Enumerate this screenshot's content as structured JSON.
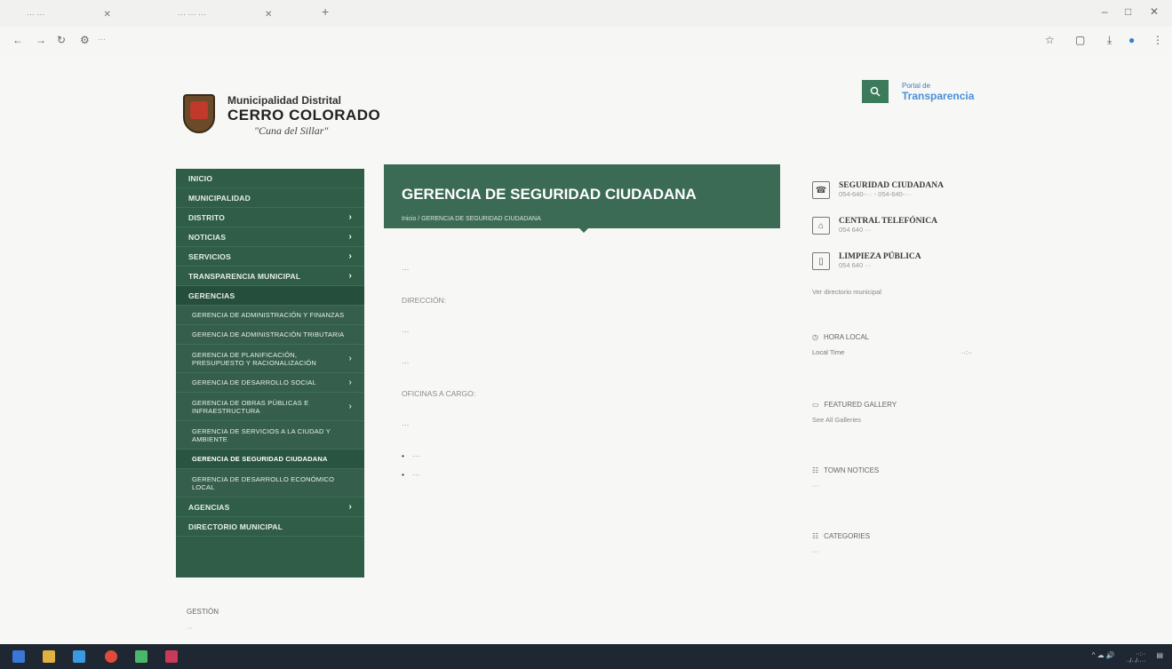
{
  "browser": {
    "tabs": [
      {
        "label": "··· ···"
      },
      {
        "label": "··· ··· ···"
      }
    ],
    "new_tab": "+",
    "url": "···",
    "window_controls": [
      "–",
      "□",
      "✕"
    ]
  },
  "header": {
    "logo": {
      "line1": "Municipalidad Distrital",
      "line2": "CERRO COLORADO",
      "line3": "\"Cuna del Sillar\""
    },
    "search_icon": "search-icon",
    "transparency": {
      "small": "Portal de",
      "big": "Transparencia"
    }
  },
  "sidebar": {
    "items": [
      {
        "label": "INICIO",
        "arrow": ""
      },
      {
        "label": "MUNICIPALIDAD",
        "arrow": ""
      },
      {
        "label": "DISTRITO",
        "arrow": "›"
      },
      {
        "label": "NOTICIAS",
        "arrow": "›"
      },
      {
        "label": "SERVICIOS",
        "arrow": "›"
      },
      {
        "label": "TRANSPARENCIA MUNICIPAL",
        "arrow": "›"
      },
      {
        "label": "GERENCIAS",
        "arrow": ""
      }
    ],
    "sub_items": [
      {
        "label": "GERENCIA DE ADMINISTRACIÓN Y FINANZAS",
        "arrow": ""
      },
      {
        "label": "GERENCIA DE ADMINISTRACIÓN TRIBUTARIA",
        "arrow": ""
      },
      {
        "label": "GERENCIA DE PLANIFICACIÓN, PRESUPUESTO Y RACIONALIZACIÓN",
        "arrow": "›"
      },
      {
        "label": "GERENCIA DE DESARROLLO SOCIAL",
        "arrow": "›"
      },
      {
        "label": "GERENCIA DE OBRAS PÚBLICAS E INFRAESTRUCTURA",
        "arrow": "›"
      },
      {
        "label": "GERENCIA DE SERVICIOS A LA CIUDAD Y AMBIENTE",
        "arrow": ""
      },
      {
        "label": "GERENCIA DE SEGURIDAD CIUDADANA",
        "arrow": ""
      },
      {
        "label": "GERENCIA DE DESARROLLO ECONÓMICO LOCAL",
        "arrow": ""
      }
    ],
    "bottom_items": [
      {
        "label": "AGENCIAS",
        "arrow": "›"
      },
      {
        "label": "DIRECTORIO MUNICIPAL",
        "arrow": ""
      }
    ]
  },
  "content": {
    "title": "GERENCIA DE SEGURIDAD CIUDADANA",
    "breadcrumb": "Inicio / GERENCIA DE SEGURIDAD CIUDADANA",
    "body": {
      "para": "···",
      "direccion_label": "DIRECCIÓN:",
      "direccion": "···",
      "horario": "···",
      "oficinas_label": "OFICINAS A CARGO:",
      "oficinas_sub": "···",
      "items": [
        "···",
        "···"
      ]
    }
  },
  "right": {
    "contacts": [
      {
        "icon": "phone-icon",
        "title": "SEGURIDAD CIUDADANA",
        "sub": "054-640-··· - 054-640-···"
      },
      {
        "icon": "building-icon",
        "title": "CENTRAL TELEFÓNICA",
        "sub": "054 640 ···"
      },
      {
        "icon": "trash-icon",
        "title": "LIMPIEZA PÚBLICA",
        "sub": "054 640 ···"
      }
    ],
    "directory_link": "Ver directorio municipal",
    "hora_local": {
      "title": "HORA LOCAL",
      "label": "Local Time",
      "value": "··:··"
    },
    "featured": {
      "title": "FEATURED GALLERY",
      "sub": "See All Galleries"
    },
    "notices": {
      "title": "TOWN NOTICES",
      "sub": "···"
    },
    "categories": {
      "title": "CATEGORIES",
      "sub": "···"
    }
  },
  "footer_left": {
    "title": "GESTIÓN",
    "sub": "···"
  },
  "taskbar": {
    "tray_text": "^ ☁ 🔊",
    "time": "··:··",
    "date": "··/··/····"
  }
}
